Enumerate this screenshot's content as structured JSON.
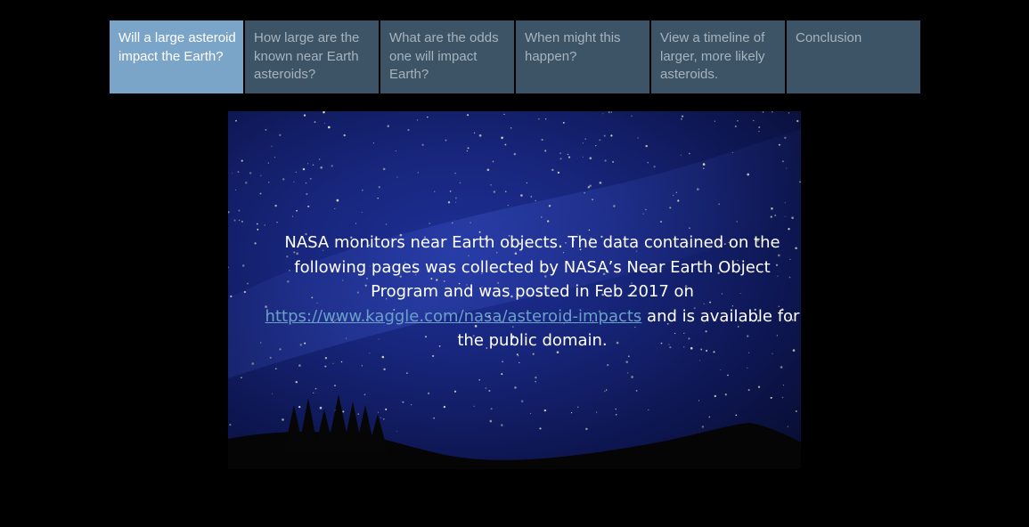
{
  "story_nav": {
    "items": [
      {
        "label": "Will a large asteroid impact the Earth?",
        "active": true
      },
      {
        "label": "How large are the known near Earth asteroids?",
        "active": false
      },
      {
        "label": "What are the odds one will impact Earth?",
        "active": false
      },
      {
        "label": "When might this happen?",
        "active": false
      },
      {
        "label": "View a timeline of larger, more likely asteroids.",
        "active": false
      },
      {
        "label": "Conclusion",
        "active": false
      }
    ]
  },
  "hero": {
    "text_before": "NASA monitors near Earth objects. The data contained on the following pages was collected by NASA’s Near Earth Object Program and was posted in Feb 2017 on",
    "link": "https://www.kaggle.com/nasa/asteroid-impacts",
    "text_after": "and is available for the public domain."
  },
  "colors": {
    "page_background": "#000000",
    "nav_active": "#7aa4c8",
    "nav_inactive": "#3c5466",
    "link": "#6ba1c8",
    "sky": "#17257a"
  }
}
